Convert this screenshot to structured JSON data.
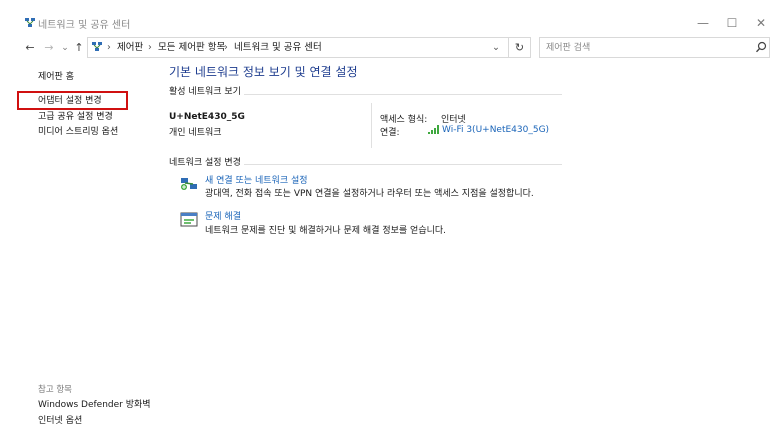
{
  "window": {
    "title": "네트워크 및 공유 센터",
    "minimize_glyph": "—",
    "maximize_glyph": "☐",
    "close_glyph": "✕"
  },
  "nav": {
    "back_glyph": "←",
    "forward_glyph": "→",
    "history_glyph": "⌄",
    "up_glyph": "↑",
    "breadcrumb": [
      "제어판",
      "모든 제어판 항목",
      "네트워크 및 공유 센터"
    ],
    "separator": "›",
    "dropdown_glyph": "⌄",
    "refresh_glyph": "↻"
  },
  "search": {
    "placeholder": "제어판 검색"
  },
  "sidebar": {
    "home": "제어판 홈",
    "items": [
      {
        "label": "어댑터 설정 변경"
      },
      {
        "label": "고급 공유 설정 변경"
      },
      {
        "label": "미디어 스트리밍 옵션"
      }
    ],
    "see_also_title": "참고 항목",
    "see_also": [
      {
        "label": "Windows Defender 방화벽"
      },
      {
        "label": "인터넷 옵션"
      }
    ]
  },
  "main": {
    "title": "기본 네트워크 정보 보기 및 연결 설정",
    "active_networks_heading": "활성 네트워크 보기",
    "network": {
      "name": "U+NetE430_5G",
      "type": "개인 네트워크",
      "access_type_label": "액세스 형식:",
      "access_type_value": "인터넷",
      "connection_label": "연결:",
      "connection_value": "Wi-Fi 3(U+NetE430_5G)"
    },
    "change_settings_heading": "네트워크 설정 변경",
    "tasks": [
      {
        "title": "새 연결 또는 네트워크 설정",
        "description": "광대역, 전화 접속 또는 VPN 연결을 설정하거나 라우터 또는 액세스 지점을 설정합니다."
      },
      {
        "title": "문제 해결",
        "description": "네트워크 문제를 진단 및 해결하거나 문제 해결 정보를 얻습니다."
      }
    ]
  },
  "colors": {
    "title_blue": "#1e3d8f",
    "link_blue": "#1a64b8",
    "highlight_red": "#d01010"
  }
}
